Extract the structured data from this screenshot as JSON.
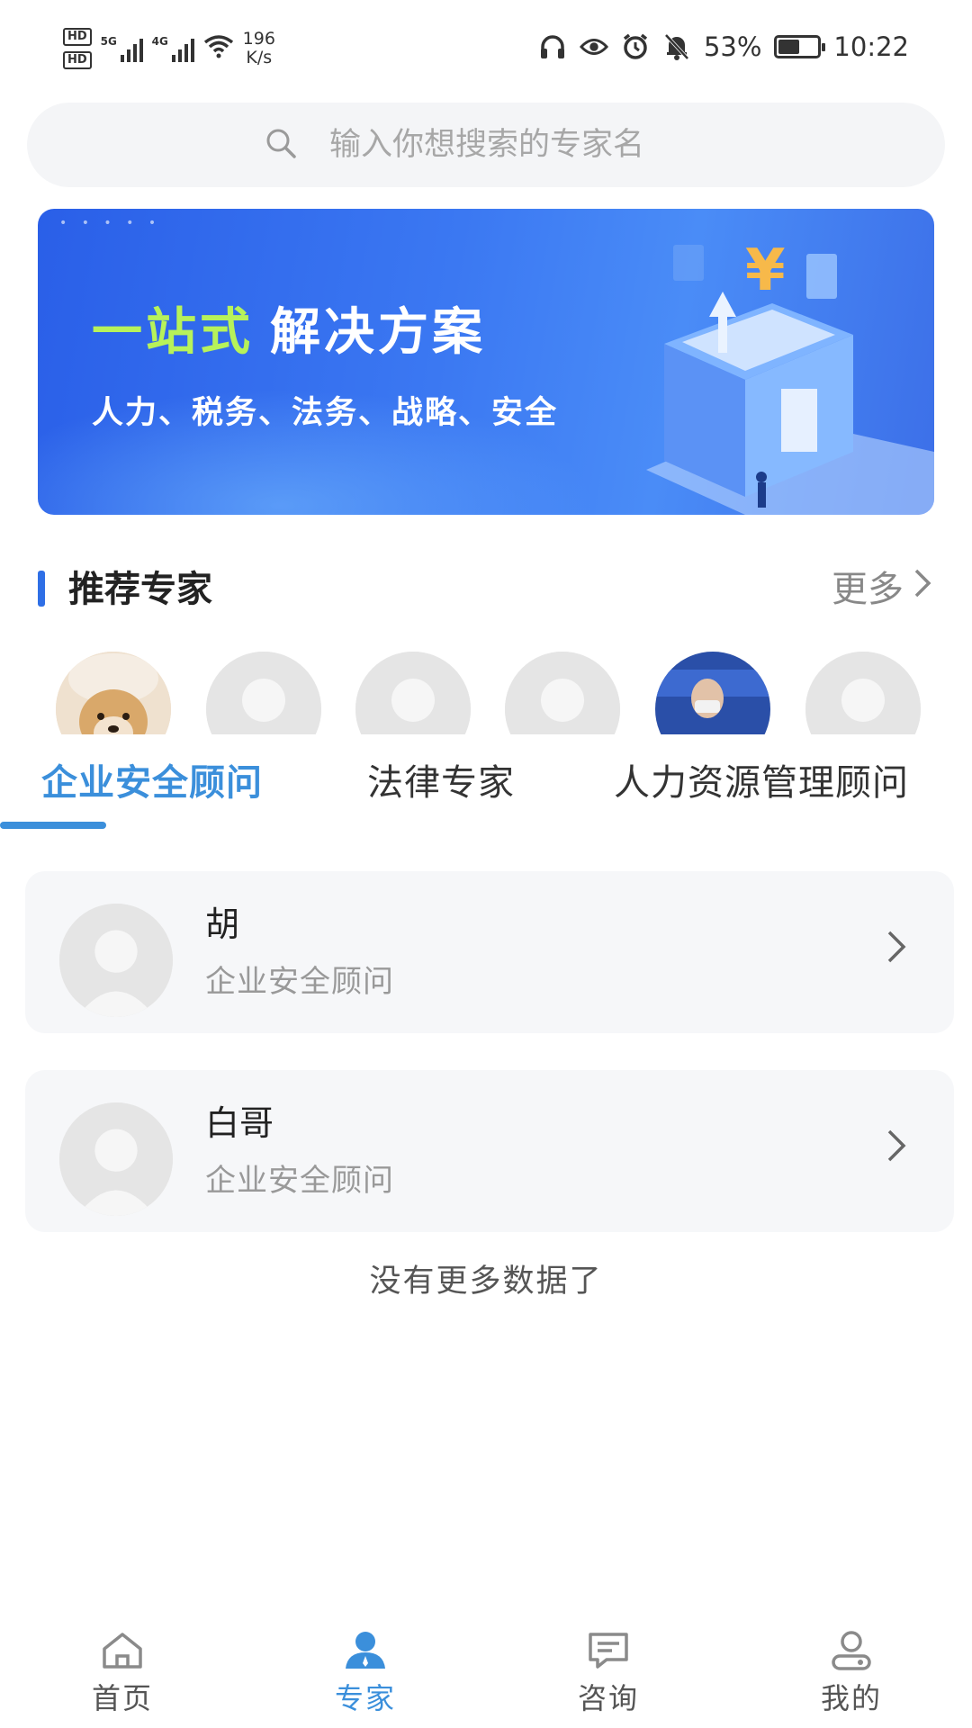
{
  "status_bar": {
    "hd1": "HD",
    "hd2": "HD",
    "net1": "5G",
    "net2": "4G",
    "speed_value": "196",
    "speed_unit": "K/s",
    "battery": "53%",
    "battery_level": 0.53,
    "time": "10:22"
  },
  "search": {
    "placeholder": "输入你想搜索的专家名"
  },
  "banner": {
    "title_highlight": "一站式",
    "title_rest": "解决方案",
    "subtitle": "人力、税务、法务、战略、安全"
  },
  "recommended": {
    "title": "推荐专家",
    "more_label": "更多"
  },
  "avatars": [
    {
      "kind": "dog-photo"
    },
    {
      "kind": "placeholder"
    },
    {
      "kind": "placeholder"
    },
    {
      "kind": "placeholder"
    },
    {
      "kind": "person-photo"
    },
    {
      "kind": "placeholder"
    }
  ],
  "tabs": [
    {
      "label": "企业安全顾问",
      "active": true
    },
    {
      "label": "法律专家",
      "active": false
    },
    {
      "label": "人力资源管理顾问",
      "active": false
    }
  ],
  "experts": [
    {
      "name": "胡",
      "role": "企业安全顾问"
    },
    {
      "name": "白哥",
      "role": "企业安全顾问"
    }
  ],
  "list_end_text": "没有更多数据了",
  "bottom_nav": [
    {
      "label": "首页",
      "icon": "home-icon",
      "active": false
    },
    {
      "label": "专家",
      "icon": "expert-icon",
      "active": true
    },
    {
      "label": "咨询",
      "icon": "chat-icon",
      "active": false
    },
    {
      "label": "我的",
      "icon": "profile-icon",
      "active": false
    }
  ],
  "colors": {
    "accent": "#3b8fdb",
    "section_bar": "#2f6fe6",
    "banner_highlight": "#b7f25a"
  }
}
